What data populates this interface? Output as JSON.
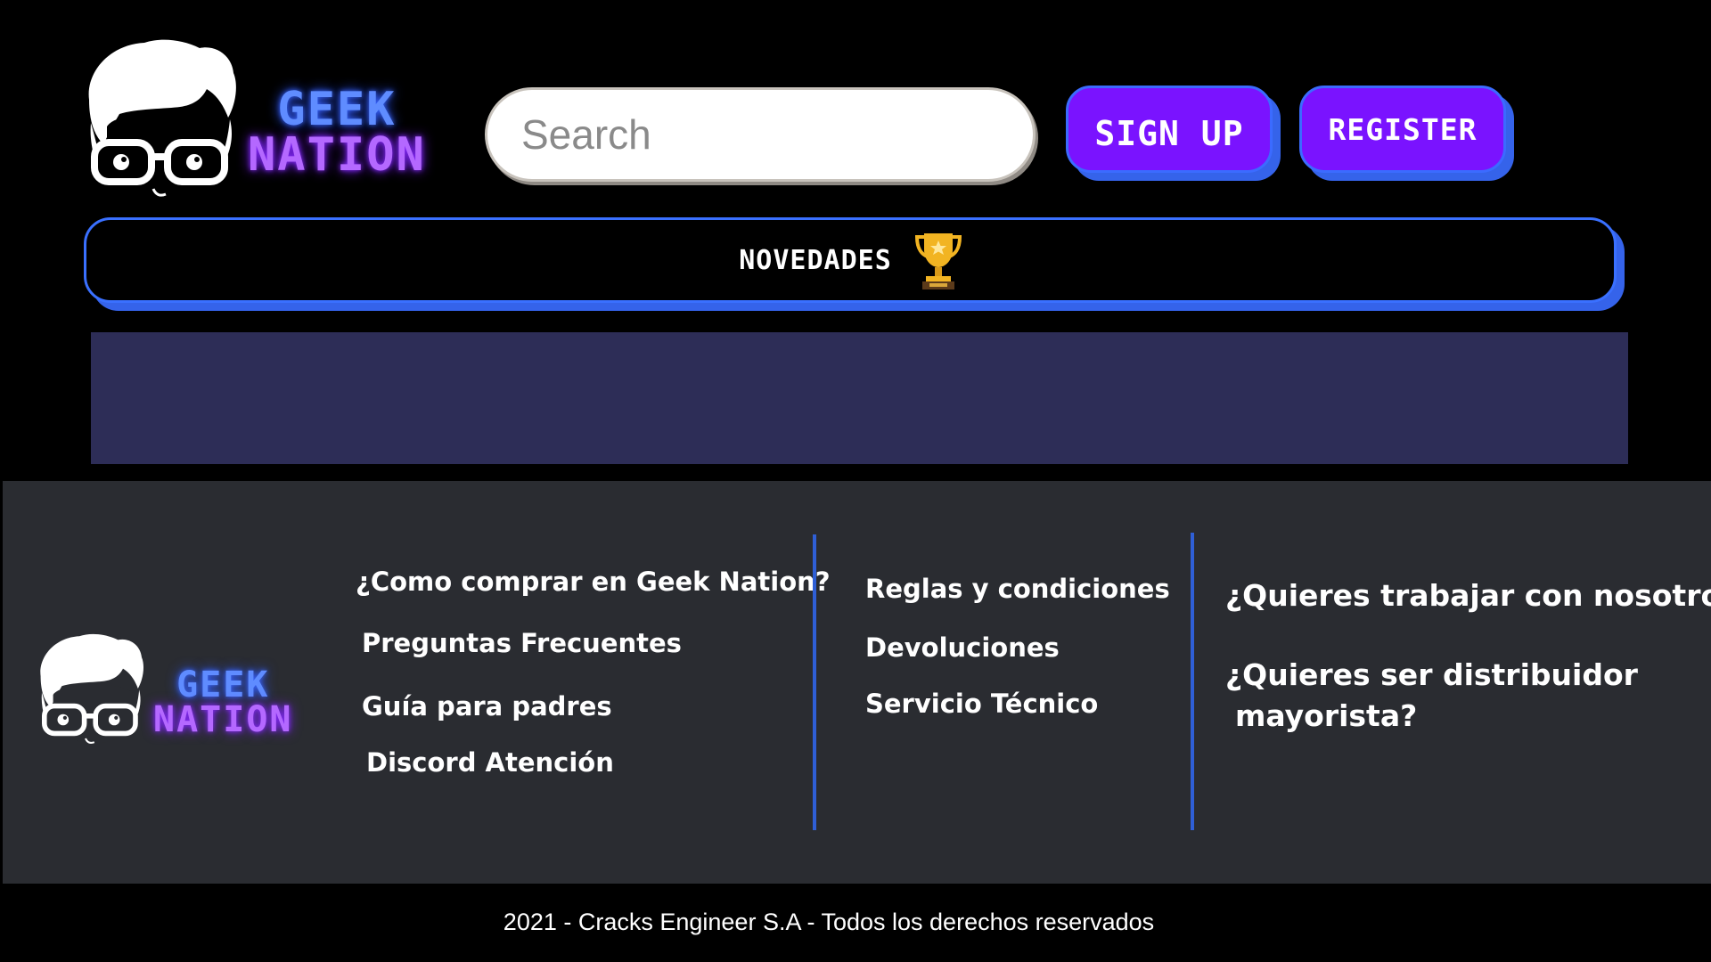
{
  "brand": {
    "line1": "GEEK",
    "line2": "NATION"
  },
  "search": {
    "placeholder": "Search"
  },
  "buttons": {
    "signup": "SIGN UP",
    "register": "REGISTER"
  },
  "nav": {
    "novedades": "NOVEDADES"
  },
  "footer": {
    "col1": [
      "¿Como comprar en Geek Nation?",
      "Preguntas Frecuentes",
      "Guía para padres",
      "Discord Atención"
    ],
    "col2": [
      "Reglas y condiciones",
      "Devoluciones",
      "Servicio Técnico"
    ],
    "col3": [
      "¿Quieres trabajar con nosotros?",
      "¿Quieres ser distribuidor",
      "mayorista?"
    ],
    "copyright": "2021 - Cracks Engineer S.A - Todos los derechos reservados"
  },
  "colors": {
    "accent_purple": "#7a13ff",
    "accent_blue": "#3563ea",
    "banner": "#2d2d57",
    "footer_bg": "#2a2c31"
  },
  "icons": [
    "geek-mascot-icon",
    "search-icon",
    "trophy-icon"
  ]
}
